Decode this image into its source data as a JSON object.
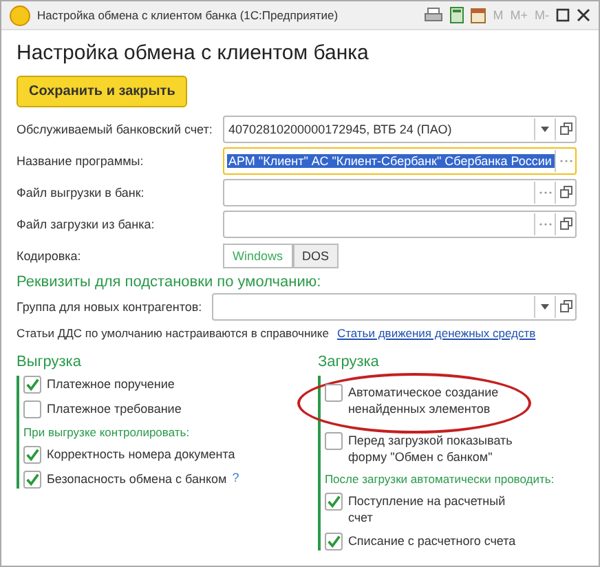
{
  "window": {
    "title": "Настройка обмена с клиентом банка  (1С:Предприятие)",
    "memory_buttons": [
      "M",
      "M+",
      "M-"
    ]
  },
  "form_title": "Настройка обмена с клиентом банка",
  "save_button": "Сохранить и закрыть",
  "fields": [
    {
      "label": "Обслуживаемый банковский счет:",
      "value": "40702810200000172945, ВТБ 24 (ПАО)",
      "kind": "dropdown",
      "selected": false
    },
    {
      "label": "Название программы:",
      "value": "АРМ \"Клиент\" АС \"Клиент-Сбербанк\" Сбербанка России",
      "kind": "choice",
      "selected": true
    },
    {
      "label": "Файл выгрузки в банк:",
      "kind": "file",
      "selected": false
    },
    {
      "label": "Файл загрузки из банка:",
      "kind": "file",
      "selected": false
    }
  ],
  "encoding": {
    "label": "Кодировка:",
    "options": [
      {
        "label": "Windows",
        "selected": true
      },
      {
        "label": "DOS",
        "selected": false
      }
    ]
  },
  "defaults": {
    "title": "Реквизиты для подстановки по умолчанию:",
    "group_label": "Группа для новых контрагентов:",
    "note": "Статьи ДДС по умолчанию настраиваются в справочнике",
    "link": "Статьи движения денежных средств"
  },
  "export": {
    "title": "Выгрузка",
    "items": [
      {
        "kind": "checkbox",
        "label": "Платежное поручение",
        "checked": true
      },
      {
        "kind": "checkbox",
        "label": "Платежное требование",
        "checked": false
      },
      {
        "kind": "subheading",
        "label": "При выгрузке контролировать:"
      },
      {
        "kind": "checkbox",
        "label": "Корректность номера документа",
        "checked": true
      },
      {
        "kind": "checkbox",
        "label": "Безопасность обмена с банком",
        "checked": true,
        "help": "?"
      }
    ]
  },
  "import": {
    "title": "Загрузка",
    "items": [
      {
        "kind": "checkbox",
        "label": "Автоматическое создание ненайденных элементов",
        "checked": false,
        "highlighted": true
      },
      {
        "kind": "checkbox",
        "label": "Перед загрузкой показывать форму \"Обмен с банком\"",
        "checked": false
      },
      {
        "kind": "subheading",
        "label": "После загрузки автоматически проводить:"
      },
      {
        "kind": "checkbox",
        "label": "Поступление на расчетный счет",
        "checked": true
      },
      {
        "kind": "checkbox",
        "label": "Списание с расчетного счета",
        "checked": true
      }
    ]
  }
}
